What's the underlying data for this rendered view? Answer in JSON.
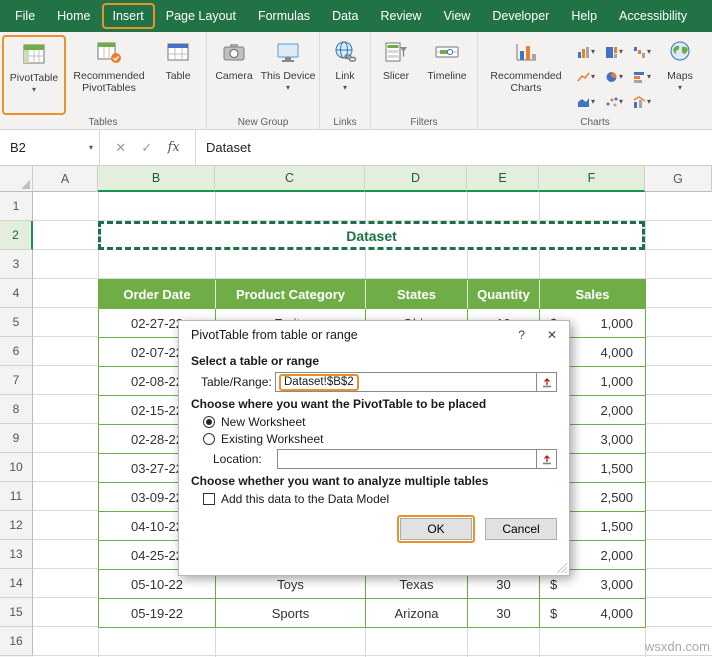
{
  "colors": {
    "excel_green": "#217346",
    "table_green": "#6FAD47",
    "highlight_orange": "#E8912D",
    "selected_header_green": "#17954F"
  },
  "icons": {
    "caret": "▾",
    "help": "?",
    "close": "✕",
    "cancel": "✕",
    "enter": "✓",
    "fx": "fx"
  },
  "ribbon": {
    "tabs": [
      "File",
      "Home",
      "Insert",
      "Page Layout",
      "Formulas",
      "Data",
      "Review",
      "View",
      "Developer",
      "Help",
      "Accessibility"
    ],
    "buttons": {
      "pivottable": "PivotTable",
      "recommended_pivottables": "Recommended PivotTables",
      "table": "Table",
      "camera": "Camera",
      "this_device": "This Device",
      "link": "Link",
      "slicer": "Slicer",
      "timeline": "Timeline",
      "recommended_charts": "Recommended Charts",
      "maps": "Maps"
    },
    "group_labels": {
      "tables": "Tables",
      "new_group": "New Group",
      "links": "Links",
      "filters": "Filters",
      "charts": "Charts"
    }
  },
  "formula_bar": {
    "name_box": "B2",
    "formula": "Dataset"
  },
  "sheet": {
    "columns": [
      "A",
      "B",
      "C",
      "D",
      "E",
      "F",
      "G"
    ],
    "row_numbers": [
      "1",
      "2",
      "3",
      "4",
      "5",
      "6",
      "7",
      "8",
      "9",
      "10",
      "11",
      "12",
      "13",
      "14",
      "15",
      "16"
    ],
    "title_cell": "Dataset"
  },
  "table": {
    "headers": [
      "Order Date",
      "Product Category",
      "States",
      "Quantity",
      "Sales"
    ],
    "rows": [
      {
        "date": "02-27-22",
        "category": "Fruits",
        "state": "Ohio",
        "qty": "10",
        "cur": "$",
        "sales": "1,000"
      },
      {
        "date": "02-07-22",
        "category": "",
        "state": "",
        "qty": "",
        "cur": "",
        "sales": "4,000"
      },
      {
        "date": "02-08-22",
        "category": "",
        "state": "",
        "qty": "",
        "cur": "",
        "sales": "1,000"
      },
      {
        "date": "02-15-22",
        "category": "",
        "state": "",
        "qty": "",
        "cur": "",
        "sales": "2,000"
      },
      {
        "date": "02-28-22",
        "category": "",
        "state": "",
        "qty": "",
        "cur": "",
        "sales": "3,000"
      },
      {
        "date": "03-27-22",
        "category": "",
        "state": "",
        "qty": "",
        "cur": "",
        "sales": "1,500"
      },
      {
        "date": "03-09-22",
        "category": "",
        "state": "",
        "qty": "",
        "cur": "",
        "sales": "2,500"
      },
      {
        "date": "04-10-22",
        "category": "",
        "state": "",
        "qty": "",
        "cur": "",
        "sales": "1,500"
      },
      {
        "date": "04-25-22",
        "category": "",
        "state": "",
        "qty": "",
        "cur": "",
        "sales": "2,000"
      },
      {
        "date": "05-10-22",
        "category": "Toys",
        "state": "Texas",
        "qty": "30",
        "cur": "$",
        "sales": "3,000"
      },
      {
        "date": "05-19-22",
        "category": "Sports",
        "state": "Arizona",
        "qty": "30",
        "cur": "$",
        "sales": "4,000"
      }
    ]
  },
  "dialog": {
    "title": "PivotTable from table or range",
    "section_range": "Select a table or range",
    "table_range_label": "Table/Range:",
    "table_range_value": "Dataset!$B$2",
    "section_placement": "Choose where you want the PivotTable to be placed",
    "radio_new": "New Worksheet",
    "radio_existing": "Existing Worksheet",
    "location_label": "Location:",
    "location_value": "",
    "section_multi": "Choose whether you want to analyze multiple tables",
    "checkbox_label": "Add this data to the Data Model",
    "ok": "OK",
    "cancel": "Cancel"
  },
  "watermark": "wsxdn.com"
}
